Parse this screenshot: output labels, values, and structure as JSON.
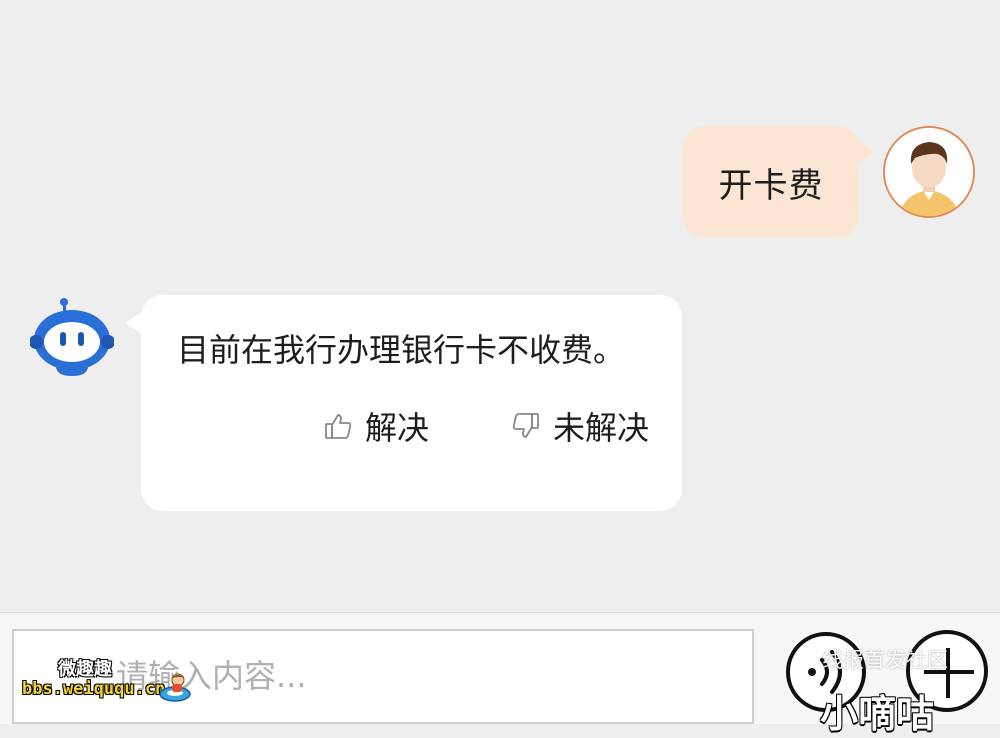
{
  "conversation": {
    "user_message": "开卡费",
    "bot_message": "目前在我行办理银行卡不收费。",
    "feedback": {
      "solved_label": "解决",
      "unsolved_label": "未解决"
    }
  },
  "input": {
    "placeholder": "请输入内容..."
  },
  "watermark": {
    "line1": "微趣趣",
    "line2": "bbs.weiququ.cn"
  },
  "overlay": {
    "top_text": "线报首发社区",
    "bottom_text": "小嘀咕"
  },
  "icons": {
    "user_avatar": "user-avatar-icon",
    "bot_avatar": "robot-avatar-icon",
    "thumbs_up": "thumbs-up-icon",
    "thumbs_down": "thumbs-down-icon",
    "voice": "voice-icon",
    "plus": "plus-icon"
  },
  "colors": {
    "background": "#eeeeee",
    "user_bubble": "#fbe6d3",
    "bot_bubble": "#ffffff",
    "bot_avatar": "#2a6fd8",
    "user_avatar_border": "#e08a55"
  }
}
